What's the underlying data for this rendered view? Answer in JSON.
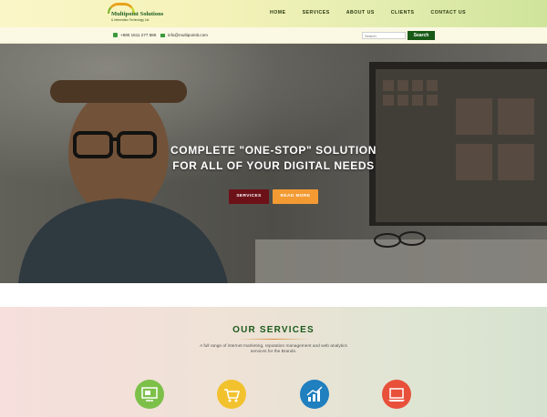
{
  "brand": {
    "title": "Multipoint Solutions",
    "tagline": "& Information Technology Ltd."
  },
  "nav": {
    "items": [
      "HOME",
      "SERVICES",
      "ABOUT US",
      "CLIENTS",
      "CONTACT US"
    ]
  },
  "contact": {
    "phone": "+880 1611 277 886",
    "email": "info@multipointit.com"
  },
  "search": {
    "placeholder": "Search",
    "button_label": "Search"
  },
  "hero": {
    "title_line1": "COMPLETE \"ONE-STOP\" SOLUTION",
    "title_line2": "FOR ALL OF YOUR DIGITAL NEEDS",
    "btn_services": "SERVICES",
    "btn_read_more": "READ MORE"
  },
  "services": {
    "heading": "OUR SERVICES",
    "description": "A full range of internet marketing, reputation management and web analytics services for the Brands.",
    "icons": [
      {
        "name": "web-design-icon",
        "color": "#7cc04a"
      },
      {
        "name": "ecommerce-cart-icon",
        "color": "#f2c12e"
      },
      {
        "name": "analytics-chart-icon",
        "color": "#1f7fbf"
      },
      {
        "name": "laptop-icon",
        "color": "#e8503a"
      }
    ]
  },
  "colors": {
    "brand_green": "#195a17",
    "accent_orange": "#f39a33",
    "maroon": "#6d1118"
  }
}
